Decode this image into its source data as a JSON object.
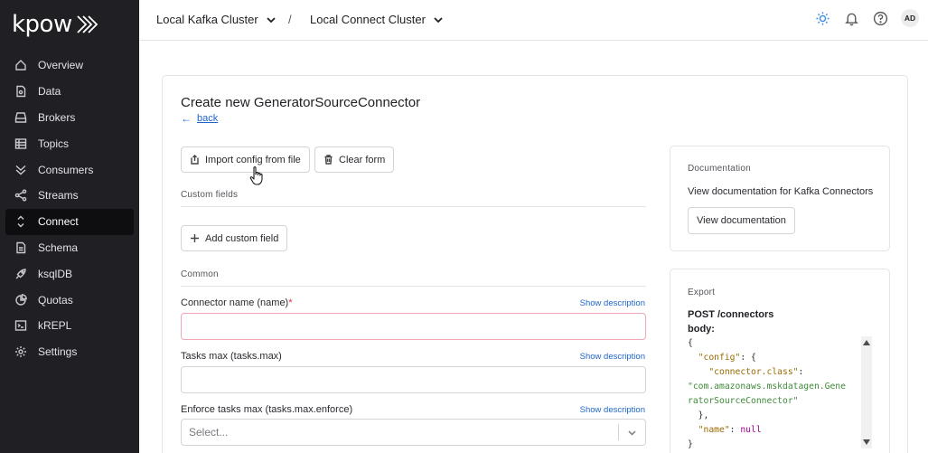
{
  "brand": {
    "logo_text": "kpow"
  },
  "sidebar": {
    "items": [
      {
        "label": "Overview",
        "icon": "home-icon"
      },
      {
        "label": "Data",
        "icon": "document-icon"
      },
      {
        "label": "Brokers",
        "icon": "drive-icon"
      },
      {
        "label": "Topics",
        "icon": "table-icon"
      },
      {
        "label": "Consumers",
        "icon": "double-chevron-icon"
      },
      {
        "label": "Streams",
        "icon": "share-icon"
      },
      {
        "label": "Connect",
        "icon": "expand-icon",
        "active": true
      },
      {
        "label": "Schema",
        "icon": "file-icon"
      },
      {
        "label": "ksqlDB",
        "icon": "rocket-icon"
      },
      {
        "label": "Quotas",
        "icon": "pie-icon"
      },
      {
        "label": "kREPL",
        "icon": "terminal-icon"
      },
      {
        "label": "Settings",
        "icon": "gear-icon"
      }
    ]
  },
  "header": {
    "cluster": "Local Kafka Cluster",
    "separator": "/",
    "connect_cluster": "Local Connect Cluster",
    "avatar_initials": "AD"
  },
  "form": {
    "title": "Create new GeneratorSourceConnector",
    "back_arrow": "←",
    "back_label": "back",
    "import_label": "Import config from file",
    "clear_label": "Clear form",
    "custom_fields_label": "Custom fields",
    "add_custom_field_label": "Add custom field",
    "common_label": "Common",
    "show_description": "Show description",
    "fields": [
      {
        "label": "Connector name (name)",
        "required_mark": "*",
        "value": ""
      },
      {
        "label": "Tasks max (tasks.max)",
        "value": ""
      },
      {
        "label": "Enforce tasks max (tasks.max.enforce)",
        "placeholder": "Select..."
      }
    ]
  },
  "documentation": {
    "title": "Documentation",
    "text": "View documentation for Kafka Connectors",
    "button": "View documentation"
  },
  "export": {
    "title": "Export",
    "method_line": "POST /connectors",
    "body_label": "body:",
    "code": {
      "open": "{",
      "config_key": "\"config\"",
      "config_open": ": {",
      "class_key": "\"connector.class\"",
      "colon": ":",
      "class_value_1": "\"com.amazonaws.mskdatagen.Gene",
      "class_value_2": "ratorSourceConnector\"",
      "config_close": "},",
      "name_key": "\"name\"",
      "name_colon": ": ",
      "name_value": "null",
      "close": "}"
    }
  },
  "colors": {
    "sidebar_bg": "#1f1f24",
    "link": "#1e66c9",
    "required": "#d92d4b",
    "theme_icon": "#3a8de6"
  }
}
